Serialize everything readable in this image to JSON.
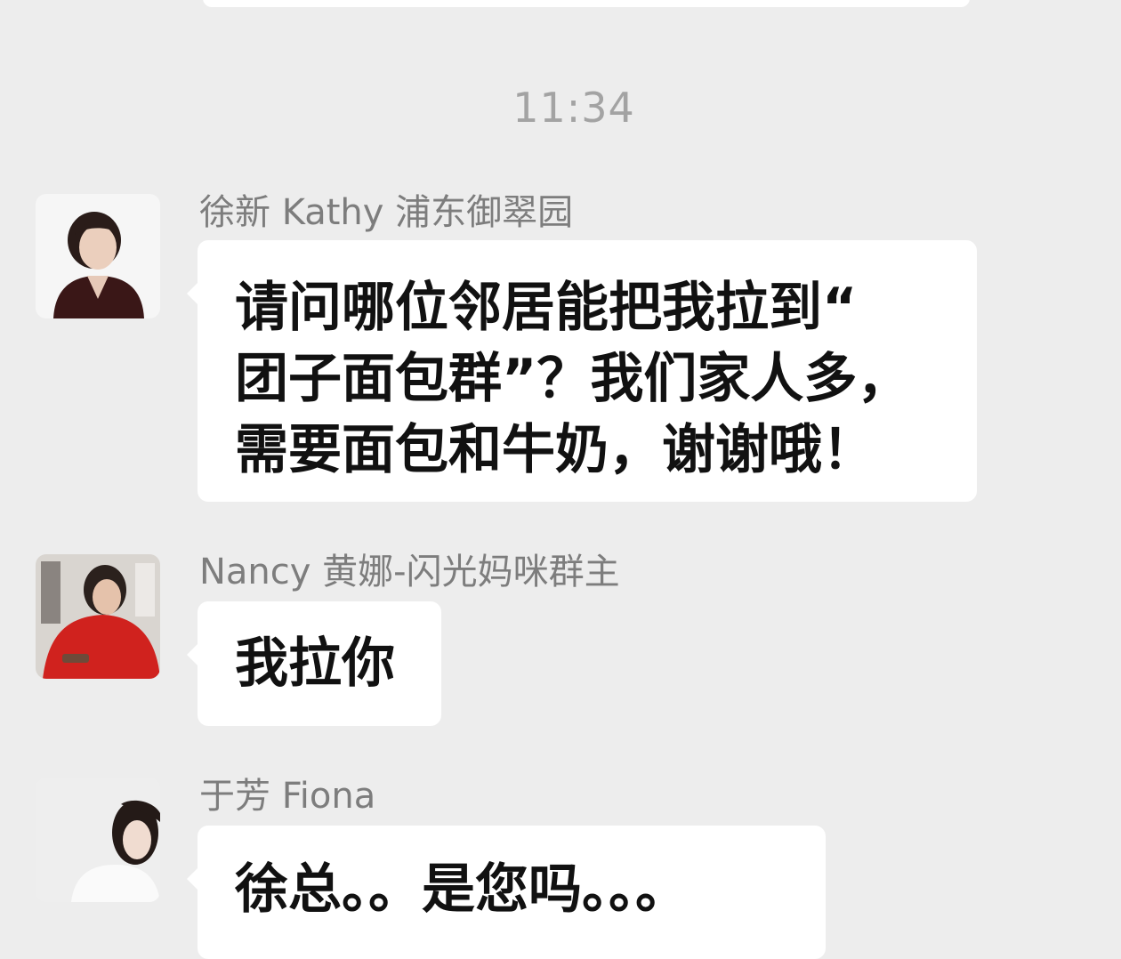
{
  "chat": {
    "timestamp": "11:34",
    "messages": [
      {
        "sender": "徐新 Kathy 浦东御翠园",
        "text": "请问哪位邻居能把我拉到“\n团子面包群”？我们家人多，\n需要面包和牛奶，谢谢哦！"
      },
      {
        "sender": "Nancy 黄娜-闪光妈咪群主",
        "text": "我拉你"
      },
      {
        "sender": "于芳 Fiona",
        "text": "徐总。。是您吗。。。"
      }
    ]
  }
}
